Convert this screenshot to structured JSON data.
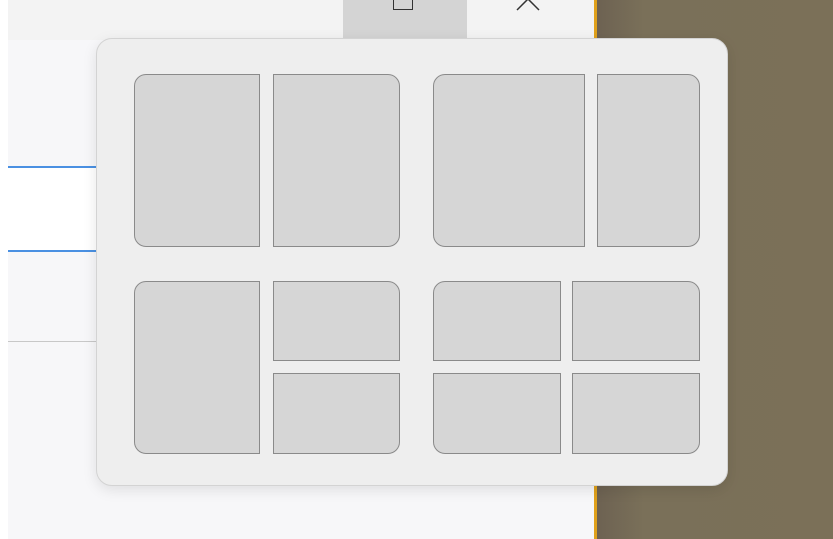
{
  "window": {
    "maximize_button": {
      "icon": "maximize-icon",
      "label": ""
    },
    "close_button": {
      "icon": "close-icon",
      "label": ""
    }
  },
  "snap_layouts": {
    "layouts": [
      {
        "name": "two-equal-columns",
        "zones": [
          "left-half",
          "right-half"
        ]
      },
      {
        "name": "wide-left-narrow-right",
        "zones": [
          "left-two-thirds",
          "right-one-third"
        ]
      },
      {
        "name": "left-half-right-stacked",
        "zones": [
          "left-half",
          "top-right-quarter",
          "bottom-right-quarter"
        ]
      },
      {
        "name": "four-quadrants",
        "zones": [
          "top-left",
          "top-right",
          "bottom-left",
          "bottom-right"
        ]
      }
    ]
  },
  "colors": {
    "accent": "#4a90e2",
    "desktop_edge": "#e0a11b",
    "zone_fill": "#d6d6d6",
    "zone_border": "#8a8a8a"
  }
}
